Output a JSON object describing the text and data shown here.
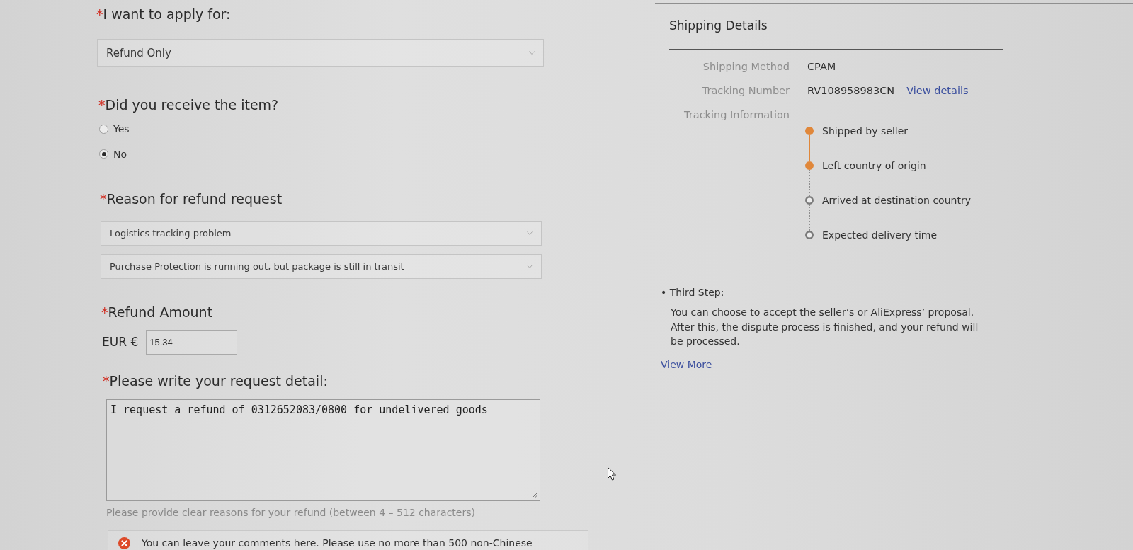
{
  "apply_for": {
    "required_mark": "*",
    "label": "I want to apply for:",
    "value": "Refund Only"
  },
  "item_received": {
    "required_mark": "*",
    "label": "Did you receive the item?",
    "options": [
      {
        "label": "Yes",
        "selected": false
      },
      {
        "label": "No",
        "selected": true
      }
    ]
  },
  "refund_reason": {
    "required_mark": "*",
    "label": "Reason for refund request",
    "selects": [
      {
        "value": "Logistics tracking problem"
      },
      {
        "value": "Purchase Protection is running out, but package is still in transit"
      }
    ]
  },
  "refund_amount": {
    "required_mark": "*",
    "label": "Refund Amount",
    "currency": "EUR €",
    "value": "15.34"
  },
  "request_detail": {
    "required_mark": "*",
    "label": "Please write your request detail:",
    "value": "I request a refund of 0312652083/0800 for undelivered goods",
    "hint": "Please provide clear reasons for your refund (between 4 – 512 characters)",
    "error": "You can leave your comments here. Please use no more than 500 non-Chinese"
  },
  "shipping_details": {
    "title": "Shipping Details",
    "fields": [
      {
        "label": "Shipping Method",
        "value": "CPAM"
      },
      {
        "label": "Tracking Number",
        "value": "RV108958983CN",
        "link": "View details"
      }
    ],
    "tracking_label": "Tracking Information",
    "tracking_steps": [
      {
        "label": "Shipped by seller",
        "done": true
      },
      {
        "label": "Left country of origin",
        "done": true
      },
      {
        "label": "Arrived at destination country",
        "done": false
      },
      {
        "label": "Expected delivery time",
        "done": false
      }
    ]
  },
  "third_step": {
    "title": "• Third Step:",
    "text": "You can choose to accept the seller’s or AliExpress’ proposal. After this, the dispute process is finished, and your refund will be processed.",
    "link": "View More"
  }
}
